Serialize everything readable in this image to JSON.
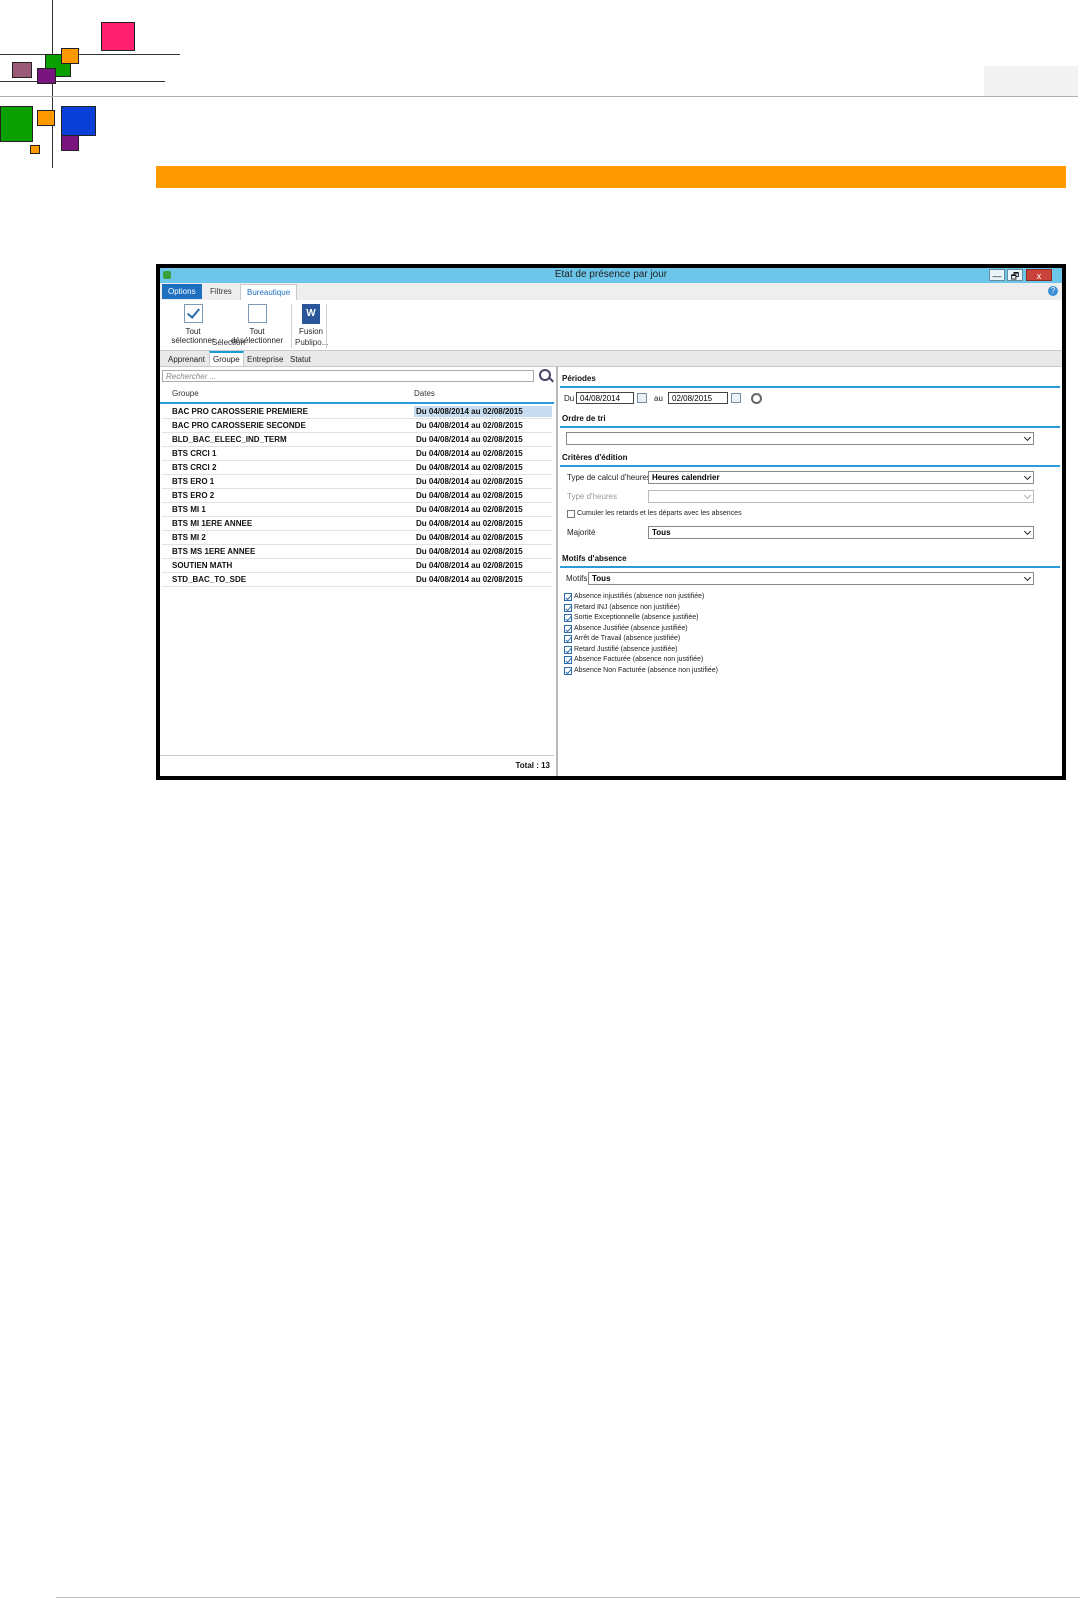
{
  "colors": {
    "orange_bar": "#ff9900",
    "pink": "#ff1f6e",
    "green": "#0aa000",
    "blue": "#0a3fd8",
    "purple": "#7a1580",
    "mauve": "#9a5a78",
    "titlebar": "#6cc6ea",
    "accent": "#2a9ad8"
  },
  "window": {
    "title": "Etat de présence par jour",
    "minimize_glyph": "—",
    "restore_glyph": "🗗",
    "close_glyph": "x",
    "help_glyph": "?"
  },
  "ribbon": {
    "tabs": [
      "Options",
      "Filtres",
      "Bureautique"
    ],
    "select_all": "Tout sélectionner",
    "deselect_all": "Tout désélectionner",
    "group_selection": "Sélection",
    "word_glyph": "W",
    "fusion": "Fusion",
    "group_publipo": "Publipo..."
  },
  "subtabs": [
    "Apprenant",
    "Groupe",
    "Entreprise",
    "Statut"
  ],
  "list": {
    "search_placeholder": "Rechercher ...",
    "col_groupe": "Groupe",
    "col_dates": "Dates",
    "rows": [
      {
        "groupe": "BAC PRO CAROSSERIE PREMIERE",
        "dates": "Du 04/08/2014 au 02/08/2015"
      },
      {
        "groupe": "BAC PRO CAROSSERIE SECONDE",
        "dates": "Du 04/08/2014 au 02/08/2015"
      },
      {
        "groupe": "BLD_BAC_ELEEC_IND_TERM",
        "dates": "Du 04/08/2014 au 02/08/2015"
      },
      {
        "groupe": "BTS CRCI 1",
        "dates": "Du 04/08/2014 au 02/08/2015"
      },
      {
        "groupe": "BTS CRCI 2",
        "dates": "Du 04/08/2014 au 02/08/2015"
      },
      {
        "groupe": "BTS ERO 1",
        "dates": "Du 04/08/2014 au 02/08/2015"
      },
      {
        "groupe": "BTS ERO 2",
        "dates": "Du 04/08/2014 au 02/08/2015"
      },
      {
        "groupe": "BTS MI 1",
        "dates": "Du 04/08/2014 au 02/08/2015"
      },
      {
        "groupe": "BTS MI 1ERE ANNEE",
        "dates": "Du 04/08/2014 au 02/08/2015"
      },
      {
        "groupe": "BTS MI 2",
        "dates": "Du 04/08/2014 au 02/08/2015"
      },
      {
        "groupe": "BTS MS 1ERE ANNEE",
        "dates": "Du 04/08/2014 au 02/08/2015"
      },
      {
        "groupe": "SOUTIEN MATH",
        "dates": "Du 04/08/2014 au 02/08/2015"
      },
      {
        "groupe": "STD_BAC_TO_SDE",
        "dates": "Du 04/08/2014 au 02/08/2015"
      }
    ],
    "total": "Total : 13"
  },
  "panel": {
    "periodes_title": "Périodes",
    "du_label": "Du",
    "du_value": "04/08/2014",
    "au_label": "au",
    "au_value": "02/08/2015",
    "ordre_title": "Ordre de tri",
    "criteres_title": "Critères d'édition",
    "type_calcul_label": "Type de calcul d'heures",
    "type_calcul_value": "Heures calendrier",
    "type_heures_label": "Type d'heures",
    "cumuler_label": "Cumuler les retards et les départs avec les absences",
    "majorite_label": "Majorité",
    "majorite_value": "Tous",
    "motifs_title": "Motifs d'absence",
    "motifs_label": "Motifs",
    "motifs_value": "Tous",
    "motifs": [
      "Absence injustifiés (absence non justifiée)",
      "Retard INJ (absence non justifiée)",
      "Sortie Exceptionnelle (absence justifiée)",
      "Absence Justifiée (absence justifiée)",
      "Arrêt de Travail (absence justifiée)",
      "Retard Justifié (absence justifiée)",
      "Absence Facturée (absence non justifiée)",
      "Absence Non Facturée (absence non justifiée)"
    ]
  }
}
